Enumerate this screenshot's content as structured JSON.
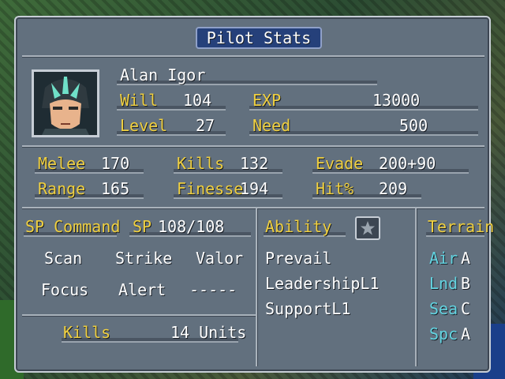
{
  "title": "Pilot Stats",
  "pilot": {
    "name": "Alan Igor",
    "will_label": "Will",
    "will": "104",
    "exp_label": "EXP",
    "exp": "13000",
    "level_label": "Level",
    "level": "27",
    "need_label": "Need",
    "need": "500"
  },
  "stats": {
    "melee_label": "Melee",
    "melee": "170",
    "range_label": "Range",
    "range": "165",
    "kills_label": "Kills",
    "kills": "132",
    "finesse_label": "Finesse",
    "finesse": "194",
    "evade_label": "Evade",
    "evade": "200+90",
    "hit_label": "Hit%",
    "hit": "209"
  },
  "sp": {
    "command_label": "SP Command",
    "sp_label": "SP",
    "sp_value": "108/108",
    "commands": [
      "Scan",
      "Strike",
      "Valor",
      "Focus",
      "Alert",
      "-----"
    ]
  },
  "ability": {
    "label": "Ability",
    "items": [
      "Prevail",
      "LeadershipL1",
      "SupportL1"
    ]
  },
  "terrain": {
    "label": "Terrain",
    "items": [
      {
        "type": "Air",
        "rank": "A"
      },
      {
        "type": "Lnd",
        "rank": "B"
      },
      {
        "type": "Sea",
        "rank": "C"
      },
      {
        "type": "Spc",
        "rank": "A"
      }
    ]
  },
  "unit_kills": {
    "label": "Kills",
    "value": "14 Units"
  },
  "icons": {
    "ability_badge": "star-icon",
    "portrait": "pilot-portrait"
  },
  "colors": {
    "panel": "#62707e",
    "label": "#f0d040",
    "terrain": "#63d3e0",
    "title_bg": "#25407a"
  }
}
